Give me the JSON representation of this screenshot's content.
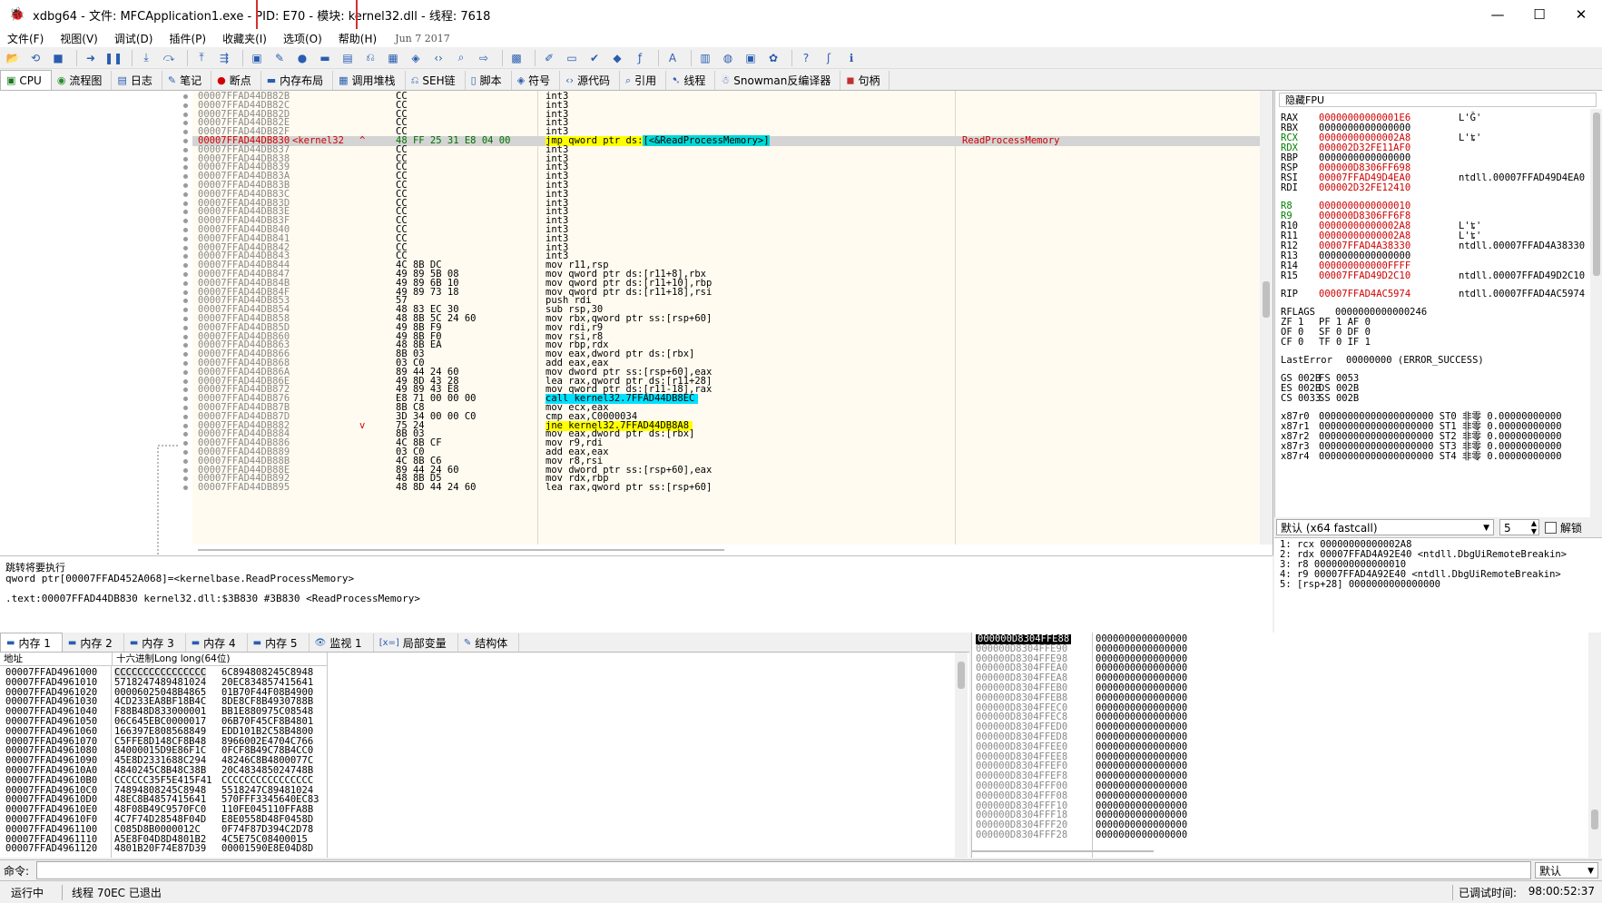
{
  "window": {
    "title": "xdbg64 - 文件: MFCApplication1.exe - PID: E70 - 模块: kernel32.dll - 线程: 7618",
    "minimize": "—",
    "maximize": "☐",
    "close": "✕"
  },
  "menu": {
    "items": [
      "文件(F)",
      "视图(V)",
      "调试(D)",
      "插件(P)",
      "收藏夹(I)",
      "选项(O)",
      "帮助(H)"
    ],
    "date": "Jun 7 2017"
  },
  "main_tabs": [
    {
      "label": "CPU",
      "icon": "cpu-icon"
    },
    {
      "label": "流程图",
      "icon": "graph-icon"
    },
    {
      "label": "日志",
      "icon": "log-icon"
    },
    {
      "label": "笔记",
      "icon": "notes-icon"
    },
    {
      "label": "断点",
      "icon": "breakpoint-icon"
    },
    {
      "label": "内存布局",
      "icon": "memory-map-icon"
    },
    {
      "label": "调用堆栈",
      "icon": "callstack-icon"
    },
    {
      "label": "SEH链",
      "icon": "seh-icon"
    },
    {
      "label": "脚本",
      "icon": "script-icon"
    },
    {
      "label": "符号",
      "icon": "symbol-icon"
    },
    {
      "label": "源代码",
      "icon": "source-icon"
    },
    {
      "label": "引用",
      "icon": "references-icon"
    },
    {
      "label": "线程",
      "icon": "threads-icon"
    },
    {
      "label": "Snowman反编译器",
      "icon": "snowman-icon"
    },
    {
      "label": "句柄",
      "icon": "handles-icon"
    }
  ],
  "disasm": {
    "selected_label": "<kernel32",
    "selected_comment": "ReadProcessMemory",
    "rows": [
      {
        "addr": "00007FFAD44DB82B",
        "bytes": "CC",
        "instr": "int3"
      },
      {
        "addr": "00007FFAD44DB82C",
        "bytes": "CC",
        "instr": "int3"
      },
      {
        "addr": "00007FFAD44DB82D",
        "bytes": "CC",
        "instr": "int3"
      },
      {
        "addr": "00007FFAD44DB82E",
        "bytes": "CC",
        "instr": "int3"
      },
      {
        "addr": "00007FFAD44DB82F",
        "bytes": "CC",
        "instr": "int3"
      },
      {
        "addr": "00007FFAD44DB830",
        "bytes": "48 FF 25 31 E8 04 00",
        "instr": "jmp qword ptr ds:[<&ReadProcessMemory>]",
        "sel": true
      },
      {
        "addr": "00007FFAD44DB837",
        "bytes": "CC",
        "instr": "int3"
      },
      {
        "addr": "00007FFAD44DB838",
        "bytes": "CC",
        "instr": "int3"
      },
      {
        "addr": "00007FFAD44DB839",
        "bytes": "CC",
        "instr": "int3"
      },
      {
        "addr": "00007FFAD44DB83A",
        "bytes": "CC",
        "instr": "int3"
      },
      {
        "addr": "00007FFAD44DB83B",
        "bytes": "CC",
        "instr": "int3"
      },
      {
        "addr": "00007FFAD44DB83C",
        "bytes": "CC",
        "instr": "int3"
      },
      {
        "addr": "00007FFAD44DB83D",
        "bytes": "CC",
        "instr": "int3"
      },
      {
        "addr": "00007FFAD44DB83E",
        "bytes": "CC",
        "instr": "int3"
      },
      {
        "addr": "00007FFAD44DB83F",
        "bytes": "CC",
        "instr": "int3"
      },
      {
        "addr": "00007FFAD44DB840",
        "bytes": "CC",
        "instr": "int3"
      },
      {
        "addr": "00007FFAD44DB841",
        "bytes": "CC",
        "instr": "int3"
      },
      {
        "addr": "00007FFAD44DB842",
        "bytes": "CC",
        "instr": "int3"
      },
      {
        "addr": "00007FFAD44DB843",
        "bytes": "CC",
        "instr": "int3"
      },
      {
        "addr": "00007FFAD44DB844",
        "bytes": "4C 8B DC",
        "instr": "mov r11,rsp"
      },
      {
        "addr": "00007FFAD44DB847",
        "bytes": "49 89 5B 08",
        "instr": "mov qword ptr ds:[r11+8],rbx"
      },
      {
        "addr": "00007FFAD44DB84B",
        "bytes": "49 89 6B 10",
        "instr": "mov qword ptr ds:[r11+10],rbp"
      },
      {
        "addr": "00007FFAD44DB84F",
        "bytes": "49 89 73 18",
        "instr": "mov qword ptr ds:[r11+18],rsi"
      },
      {
        "addr": "00007FFAD44DB853",
        "bytes": "57",
        "instr": "push rdi"
      },
      {
        "addr": "00007FFAD44DB854",
        "bytes": "48 83 EC 30",
        "instr": "sub rsp,30"
      },
      {
        "addr": "00007FFAD44DB858",
        "bytes": "48 8B 5C 24 60",
        "instr": "mov rbx,qword ptr ss:[rsp+60]"
      },
      {
        "addr": "00007FFAD44DB85D",
        "bytes": "49 8B F9",
        "instr": "mov rdi,r9"
      },
      {
        "addr": "00007FFAD44DB860",
        "bytes": "49 8B F0",
        "instr": "mov rsi,r8"
      },
      {
        "addr": "00007FFAD44DB863",
        "bytes": "48 8B EA",
        "instr": "mov rbp,rdx"
      },
      {
        "addr": "00007FFAD44DB866",
        "bytes": "8B 03",
        "instr": "mov eax,dword ptr ds:[rbx]"
      },
      {
        "addr": "00007FFAD44DB868",
        "bytes": "03 C0",
        "instr": "add eax,eax"
      },
      {
        "addr": "00007FFAD44DB86A",
        "bytes": "89 44 24 60",
        "instr": "mov dword ptr ss:[rsp+60],eax"
      },
      {
        "addr": "00007FFAD44DB86E",
        "bytes": "49 8D 43 28",
        "instr": "lea rax,qword ptr ds:[r11+28]"
      },
      {
        "addr": "00007FFAD44DB872",
        "bytes": "49 89 43 E8",
        "instr": "mov qword ptr ds:[r11-18],rax"
      },
      {
        "addr": "00007FFAD44DB876",
        "bytes": "E8 71 00 00 00",
        "instr": "call kernel32.7FFAD44DB8EC",
        "hl": "call"
      },
      {
        "addr": "00007FFAD44DB87B",
        "bytes": "8B C8",
        "instr": "mov ecx,eax"
      },
      {
        "addr": "00007FFAD44DB87D",
        "bytes": "3D 34 00 00 C0",
        "instr": "cmp eax,C0000034"
      },
      {
        "addr": "00007FFAD44DB882",
        "bytes": "75 24",
        "instr": "jne kernel32.7FFAD44DB8A8",
        "hl": "jmp"
      },
      {
        "addr": "00007FFAD44DB884",
        "bytes": "8B 03",
        "instr": "mov eax,dword ptr ds:[rbx]"
      },
      {
        "addr": "00007FFAD44DB886",
        "bytes": "4C 8B CF",
        "instr": "mov r9,rdi"
      },
      {
        "addr": "00007FFAD44DB889",
        "bytes": "03 C0",
        "instr": "add eax,eax"
      },
      {
        "addr": "00007FFAD44DB88B",
        "bytes": "4C 8B C6",
        "instr": "mov r8,rsi"
      },
      {
        "addr": "00007FFAD44DB88E",
        "bytes": "89 44 24 60",
        "instr": "mov dword ptr ss:[rsp+60],eax"
      },
      {
        "addr": "00007FFAD44DB892",
        "bytes": "48 8B D5",
        "instr": "mov rdx,rbp"
      },
      {
        "addr": "00007FFAD44DB895",
        "bytes": "48 8D 44 24 60",
        "instr": "lea rax,qword ptr ss:[rsp+60]"
      }
    ]
  },
  "cpu_info": {
    "line1": "跳转将要执行",
    "line2": "qword ptr[00007FFAD452A068]=<kernelbase.ReadProcessMemory>",
    "line3": ".text:00007FFAD44DB830 kernel32.dll:$3B830 #3B830 <ReadProcessMemory>"
  },
  "registers": {
    "header": "隐藏FPU",
    "rows": [
      {
        "n": "RAX",
        "v": "00000000000001E6",
        "c": "L'Ǧ'",
        "red": true
      },
      {
        "n": "RBX",
        "v": "0000000000000000",
        "c": ""
      },
      {
        "n": "RCX",
        "v": "00000000000002A8",
        "c": "L'ʨ'",
        "red": true,
        "nc": "#008000"
      },
      {
        "n": "RDX",
        "v": "000002D32FE11AF0",
        "c": "",
        "red": true,
        "nc": "#008000"
      },
      {
        "n": "RBP",
        "v": "0000000000000000",
        "c": ""
      },
      {
        "n": "RSP",
        "v": "000000D8306FF698",
        "c": "",
        "red": true
      },
      {
        "n": "RSI",
        "v": "00007FFAD49D4EA0",
        "c": "ntdll.00007FFAD49D4EA0",
        "red": true
      },
      {
        "n": "RDI",
        "v": "000002D32FE12410",
        "c": "",
        "red": true
      },
      {
        "gap": true
      },
      {
        "n": "R8",
        "v": "0000000000000010",
        "c": "",
        "red": true,
        "nc": "#008000"
      },
      {
        "n": "R9",
        "v": "000000D8306FF6F8",
        "c": "",
        "red": true,
        "nc": "#008000"
      },
      {
        "n": "R10",
        "v": "00000000000002A8",
        "c": "L'ʨ'",
        "red": true
      },
      {
        "n": "R11",
        "v": "00000000000002A8",
        "c": "L'ʨ'",
        "red": true
      },
      {
        "n": "R12",
        "v": "00007FFAD4A38330",
        "c": "ntdll.00007FFAD4A38330",
        "red": true
      },
      {
        "n": "R13",
        "v": "0000000000000000",
        "c": ""
      },
      {
        "n": "R14",
        "v": "000000000000FFFF",
        "c": "",
        "red": true
      },
      {
        "n": "R15",
        "v": "00007FFAD49D2C10",
        "c": "ntdll.00007FFAD49D2C10",
        "red": true
      },
      {
        "gap": true
      },
      {
        "n": "RIP",
        "v": "00007FFAD4AC5974",
        "c": "ntdll.00007FFAD4AC5974",
        "red": true
      },
      {
        "gap": true
      },
      {
        "n": "RFLAGS",
        "v": "0000000000000246",
        "c": "",
        "vx": 60
      },
      {
        "n": "ZF 1",
        "v": "PF 1  AF 0",
        "c": ""
      },
      {
        "n": "OF 0",
        "v": "SF 0  DF 0",
        "c": ""
      },
      {
        "n": "CF 0",
        "v": "TF 0  IF 1",
        "c": ""
      },
      {
        "gap": true
      },
      {
        "n": "LastError",
        "v": "00000000 (ERROR_SUCCESS)",
        "c": "",
        "vx": 72
      },
      {
        "gap": true
      },
      {
        "n": "GS 002B",
        "v": "FS 0053",
        "c": ""
      },
      {
        "n": "ES 002B",
        "v": "DS 002B",
        "c": ""
      },
      {
        "n": "CS 0033",
        "v": "SS 002B",
        "c": ""
      },
      {
        "gap": true
      },
      {
        "n": "x87r0",
        "v": "00000000000000000000 ST0 非零 0.00000000000",
        "c": ""
      },
      {
        "n": "x87r1",
        "v": "00000000000000000000 ST1 非零 0.00000000000",
        "c": ""
      },
      {
        "n": "x87r2",
        "v": "00000000000000000000 ST2 非零 0.00000000000",
        "c": ""
      },
      {
        "n": "x87r3",
        "v": "00000000000000000000 ST3 非零 0.00000000000",
        "c": ""
      },
      {
        "n": "x87r4",
        "v": "00000000000000000000 ST4 非零 0.00000000000",
        "c": ""
      }
    ]
  },
  "args": {
    "convention": "默认 (x64 fastcall)",
    "count": "5",
    "unlock": "解锁",
    "rows": [
      "1: rcx 00000000000002A8",
      "2: rdx 00007FFAD4A92E40 <ntdll.DbgUiRemoteBreakin>",
      "3: r8 0000000000000010",
      "4: r9 00007FFAD4A92E40 <ntdll.DbgUiRemoteBreakin>",
      "5: [rsp+28] 0000000000000000"
    ]
  },
  "bottom_tabs": [
    {
      "label": "内存 1",
      "icon": "memory-icon"
    },
    {
      "label": "内存 2",
      "icon": "memory-icon"
    },
    {
      "label": "内存 3",
      "icon": "memory-icon"
    },
    {
      "label": "内存 4",
      "icon": "memory-icon"
    },
    {
      "label": "内存 5",
      "icon": "memory-icon"
    },
    {
      "label": "监视 1",
      "icon": "watch-icon"
    },
    {
      "label": "局部变量",
      "icon": "locals-icon"
    },
    {
      "label": "结构体",
      "icon": "struct-icon"
    }
  ],
  "dump": {
    "col_addr": "地址",
    "col_hex": "十六进制Long long(64位)",
    "rows": [
      {
        "a": "00007FFAD4961000",
        "v1": "CCCCCCCCCCCCCCCC",
        "v2": "6C894808245C8948"
      },
      {
        "a": "00007FFAD4961010",
        "v1": "5718247489481024",
        "v2": "20EC834857415641"
      },
      {
        "a": "00007FFAD4961020",
        "v1": "00006025048B4865",
        "v2": "01B70F44F08B4900"
      },
      {
        "a": "00007FFAD4961030",
        "v1": "4CD233EA8BF18B4C",
        "v2": "8DE8CF8B4930788B"
      },
      {
        "a": "00007FFAD4961040",
        "v1": "F88B48D833000001",
        "v2": "BB1E880975C08548"
      },
      {
        "a": "00007FFAD4961050",
        "v1": "06C645EBC0000017",
        "v2": "06B70F45CF8B4801"
      },
      {
        "a": "00007FFAD4961060",
        "v1": "166397E808568849",
        "v2": "EDD101B2C58B4800"
      },
      {
        "a": "00007FFAD4961070",
        "v1": "C5FFE8D148CF8B48",
        "v2": "8966002E4704C766"
      },
      {
        "a": "00007FFAD4961080",
        "v1": "84000015D9E86F1C",
        "v2": "0FCF8B49C78B4CC0"
      },
      {
        "a": "00007FFAD4961090",
        "v1": "45E8D2331688C294",
        "v2": "48246C8B4800077C"
      },
      {
        "a": "00007FFAD49610A0",
        "v1": "4840245C8B48C38B",
        "v2": "20C483485024748B"
      },
      {
        "a": "00007FFAD49610B0",
        "v1": "CCCCCC35F5E415F41",
        "v2": "CCCCCCCCCCCCCCCC"
      },
      {
        "a": "00007FFAD49610C0",
        "v1": "74894808245C8948",
        "v2": "5518247C89481024"
      },
      {
        "a": "00007FFAD49610D0",
        "v1": "48EC8B4857415641",
        "v2": "570FFF3345640EC83"
      },
      {
        "a": "00007FFAD49610E0",
        "v1": "48F08B49C9570FC0",
        "v2": "110FE045110FFA8B"
      },
      {
        "a": "00007FFAD49610F0",
        "v1": "4C7F74D28548F04D",
        "v2": "E8E0558D48F0458D"
      },
      {
        "a": "00007FFAD4961100",
        "v1": "C085D8B0000012C",
        "v2": "0F74F87D394C2D78"
      },
      {
        "a": "00007FFAD4961110",
        "v1": "A5E8F04D8D4801B2",
        "v2": "4C5E75C08400015"
      },
      {
        "a": "00007FFAD4961120",
        "v1": "4801B20F74E87D39",
        "v2": "00001590E8E04D8D"
      }
    ]
  },
  "stack": {
    "rows": [
      {
        "a": "000000D8304FFE88",
        "v": "0000000000000000"
      },
      {
        "a": "000000D8304FFE90",
        "v": "0000000000000000"
      },
      {
        "a": "000000D8304FFE98",
        "v": "0000000000000000"
      },
      {
        "a": "000000D8304FFEA0",
        "v": "0000000000000000"
      },
      {
        "a": "000000D8304FFEA8",
        "v": "0000000000000000"
      },
      {
        "a": "000000D8304FFEB0",
        "v": "0000000000000000"
      },
      {
        "a": "000000D8304FFEB8",
        "v": "0000000000000000"
      },
      {
        "a": "000000D8304FFEC0",
        "v": "0000000000000000"
      },
      {
        "a": "000000D8304FFEC8",
        "v": "0000000000000000"
      },
      {
        "a": "000000D8304FFED0",
        "v": "0000000000000000"
      },
      {
        "a": "000000D8304FFED8",
        "v": "0000000000000000"
      },
      {
        "a": "000000D8304FFEE0",
        "v": "0000000000000000"
      },
      {
        "a": "000000D8304FFEE8",
        "v": "0000000000000000"
      },
      {
        "a": "000000D8304FFEF0",
        "v": "0000000000000000"
      },
      {
        "a": "000000D8304FFEF8",
        "v": "0000000000000000"
      },
      {
        "a": "000000D8304FFF00",
        "v": "0000000000000000"
      },
      {
        "a": "000000D8304FFF08",
        "v": "0000000000000000"
      },
      {
        "a": "000000D8304FFF10",
        "v": "0000000000000000"
      },
      {
        "a": "000000D8304FFF18",
        "v": "0000000000000000"
      },
      {
        "a": "000000D8304FFF20",
        "v": "0000000000000000"
      },
      {
        "a": "000000D8304FFF28",
        "v": "0000000000000000"
      }
    ]
  },
  "command": {
    "label": "命令:",
    "mode": "默认"
  },
  "status": {
    "state": "运行中",
    "message": "线程 70EC 已退出",
    "elapsed_label": "已调试时间:",
    "elapsed": "98:00:52:37"
  },
  "colors": {
    "accent_red": "#d00000",
    "call_bg": "#00e0ff",
    "call_fg": "#ffff00",
    "mem_bracket": "#00d7d7"
  }
}
